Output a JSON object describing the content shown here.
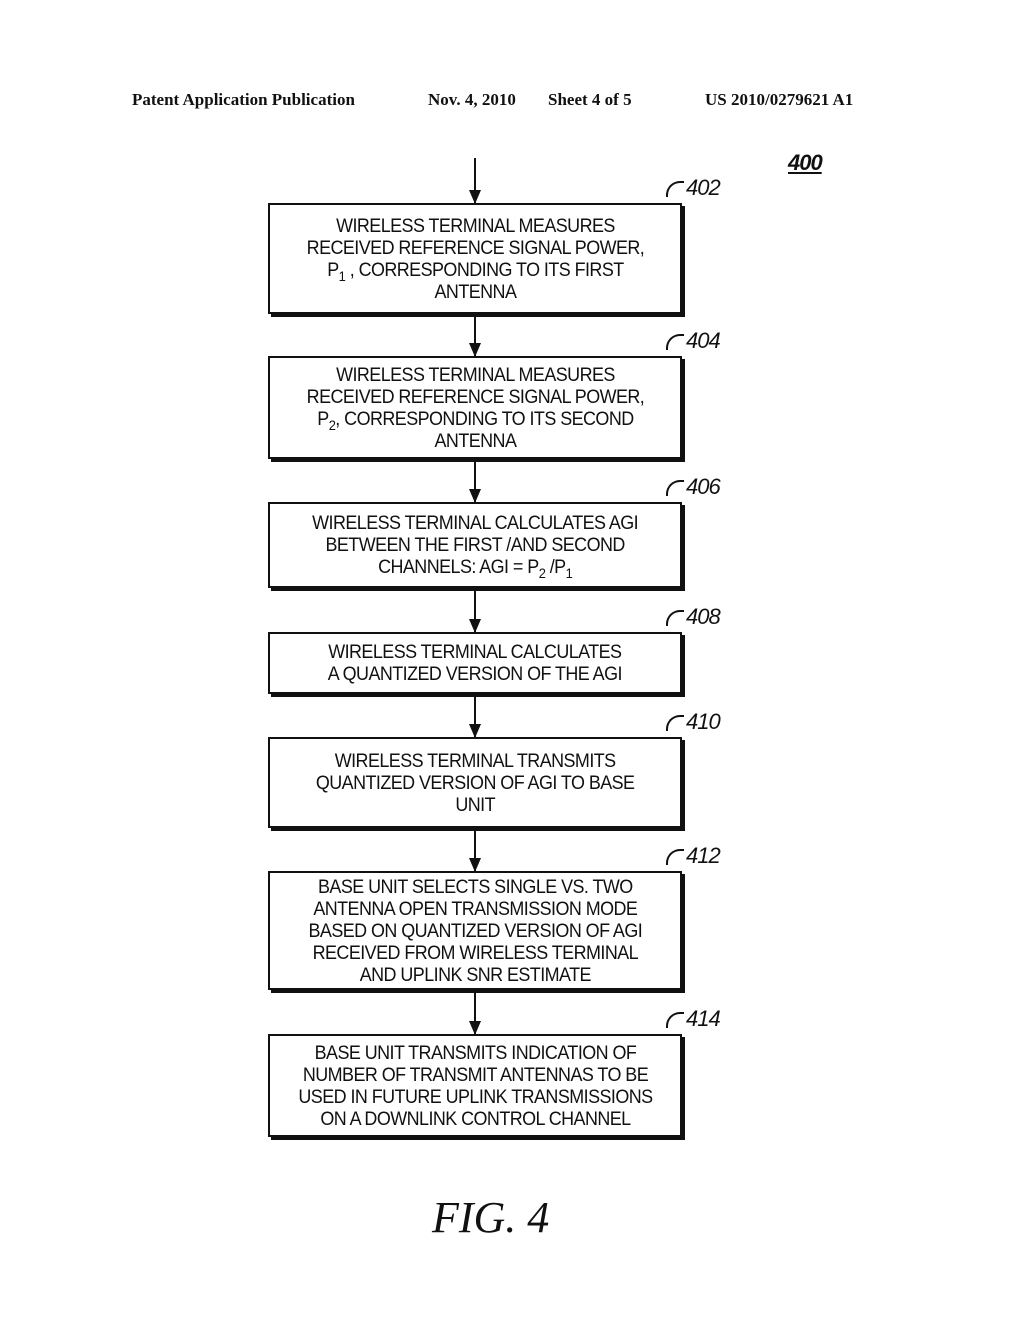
{
  "header": {
    "publication": "Patent Application Publication",
    "date": "Nov. 4, 2010",
    "sheet": "Sheet 4 of 5",
    "number": "US 2010/0279621 A1"
  },
  "figure": {
    "id": "400",
    "caption": "FIG. 4"
  },
  "steps": [
    {
      "ref": "402",
      "lines": [
        "WIRELESS TERMINAL MEASURES",
        "RECEIVED REFERENCE SIGNAL POWER,",
        "P",
        "1",
        " , CORRESPONDING TO ITS FIRST",
        "ANTENNA"
      ]
    },
    {
      "ref": "404",
      "lines": [
        "WIRELESS TERMINAL MEASURES",
        "RECEIVED REFERENCE SIGNAL POWER,",
        "P",
        "2",
        ", CORRESPONDING TO ITS SECOND",
        "ANTENNA"
      ]
    },
    {
      "ref": "406",
      "lines": [
        "WIRELESS TERMINAL CALCULATES AGI",
        "BETWEEN THE FIRST /AND SECOND",
        "CHANNELS: AGI = P",
        "2",
        " /P",
        "1"
      ]
    },
    {
      "ref": "408",
      "lines": [
        "WIRELESS TERMINAL CALCULATES",
        "A QUANTIZED VERSION OF THE AGI"
      ]
    },
    {
      "ref": "410",
      "lines": [
        "WIRELESS TERMINAL TRANSMITS",
        "QUANTIZED VERSION OF AGI TO BASE",
        "UNIT"
      ]
    },
    {
      "ref": "412",
      "lines": [
        "BASE UNIT SELECTS SINGLE VS. TWO",
        "ANTENNA OPEN TRANSMISSION MODE",
        "BASED ON QUANTIZED VERSION OF AGI",
        "RECEIVED FROM WIRELESS TERMINAL",
        "AND UPLINK SNR ESTIMATE"
      ]
    },
    {
      "ref": "414",
      "lines": [
        "BASE UNIT TRANSMITS INDICATION OF",
        "NUMBER OF TRANSMIT ANTENNAS TO BE",
        "USED IN FUTURE UPLINK TRANSMISSIONS",
        "ON A DOWNLINK CONTROL CHANNEL"
      ]
    }
  ]
}
